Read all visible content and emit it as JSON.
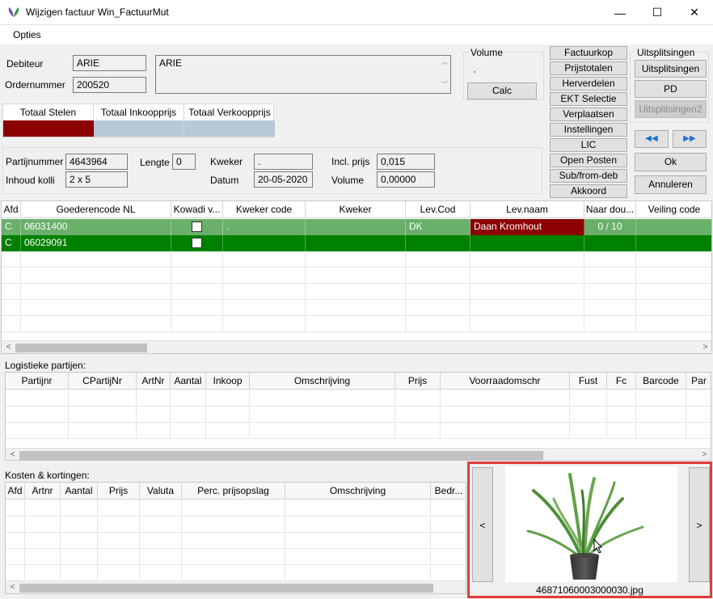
{
  "window": {
    "title": "Wijzigen factuur Win_FactuurMut",
    "minimize": "—",
    "maximize": "☐",
    "close": "✕"
  },
  "menu": {
    "opties": "Opties"
  },
  "header": {
    "debiteur_label": "Debiteur",
    "debiteur_value": "ARIE",
    "ordernummer_label": "Ordernummer",
    "ordernummer_value": "200520",
    "note_value": "ARIE"
  },
  "volume": {
    "label": "Volume",
    "value": "-",
    "calc": "Calc"
  },
  "actions": [
    "Factuurkop",
    "Prijstotalen",
    "Herverdelen",
    "EKT Selectie",
    "Verplaatsen",
    "Instellingen",
    "LIC",
    "Open Posten",
    "Sub/from-deb",
    "Akkoord"
  ],
  "split": {
    "title": "Uitsplitsingen",
    "btn1": "Uitsplitsingen",
    "btn2": "PD",
    "btn3": "Uitsplitsingen2",
    "prev": "◀◀",
    "next": "▶▶",
    "ok": "Ok",
    "cancel": "Annuleren"
  },
  "totals": {
    "col1": "Totaal Stelen",
    "col2": "Totaal Inkoopprijs",
    "col3": "Totaal Verkoopprijs"
  },
  "details": {
    "partijnummer_label": "Partijnummer",
    "partijnummer_value": "4643964",
    "inhoud_label": "Inhoud kolli",
    "inhoud_value": "2 x 5",
    "lengte_label": "Lengte",
    "lengte_value": "0",
    "kweker_label": "Kweker",
    "kweker_value": ".",
    "datum_label": "Datum",
    "datum_value": "20-05-2020",
    "inclprijs_label": "Incl. prijs",
    "inclprijs_value": "0,015",
    "volume_label": "Volume",
    "volume_value": "0,00000"
  },
  "main_grid": {
    "columns": [
      "Afd",
      "Goederencode NL",
      "Kowadi v...",
      "Kweker code",
      "Kweker",
      "Lev.Cod",
      "Lev.naam",
      "Naar dou...",
      "Veiling code"
    ],
    "rows": [
      {
        "afd": "C",
        "code": "06031400",
        "kweker_code": ".",
        "kweker": "",
        "levcod": "DK",
        "levnaam": "Daan Kromhout",
        "naar": "0 / 10",
        "veiling": ""
      },
      {
        "afd": "C",
        "code": "06029091",
        "kweker_code": "",
        "kweker": "",
        "levcod": "",
        "levnaam": "",
        "naar": "",
        "veiling": ""
      }
    ]
  },
  "logistiek": {
    "label": "Logistieke partijen:",
    "columns": [
      "Partijnr",
      "CPartijNr",
      "ArtNr",
      "Aantal",
      "Inkoop",
      "Omschrijving",
      "Prijs",
      "Voorraadomschr",
      "Fust",
      "Fc",
      "Barcode",
      "Par"
    ]
  },
  "kosten": {
    "label": "Kosten & kortingen:",
    "columns": [
      "Afd",
      "Artnr",
      "Aantal",
      "Prijs",
      "Valuta",
      "Perc. prijsopslag",
      "Omschrijving",
      "Bedr..."
    ]
  },
  "image_panel": {
    "filename": "46871060003000030.jpg",
    "prev": "<",
    "next": ">"
  },
  "colors": {
    "green_row": "#6aaf6a",
    "green_selected": "#008000",
    "dark_red": "#8b0000",
    "totals_blue": "#b8c8d8",
    "highlight_border": "#e03c3c"
  }
}
